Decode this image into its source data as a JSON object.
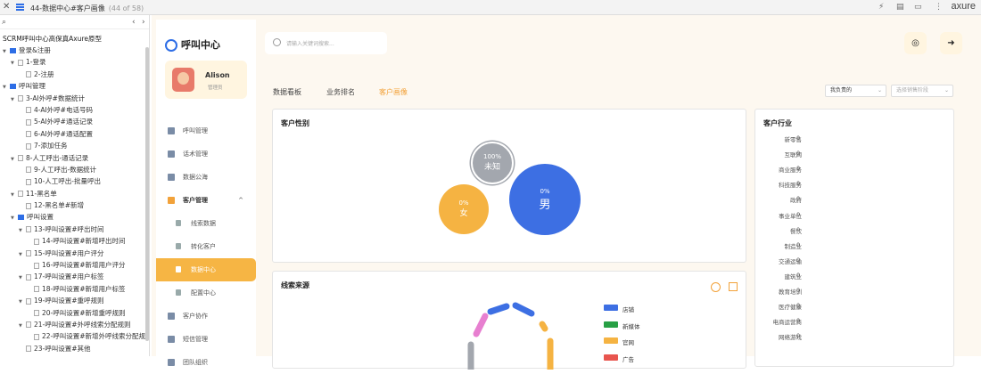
{
  "topbar": {
    "title": "44-数据中心#客户画像",
    "count": "(44 of 58)",
    "logo": "axure"
  },
  "tree": {
    "project": "SCRM呼叫中心高保真Axure原型",
    "items": [
      {
        "label": "登录&注册",
        "lvl": 0,
        "folder": true
      },
      {
        "label": "1-登录",
        "lvl": 1,
        "folder": false,
        "exp": true
      },
      {
        "label": "2-注册",
        "lvl": 2,
        "folder": false
      },
      {
        "label": "呼叫管理",
        "lvl": 0,
        "folder": true
      },
      {
        "label": "3-AI外呼#数据统计",
        "lvl": 1,
        "folder": false,
        "exp": true
      },
      {
        "label": "4-AI外呼#电话号码",
        "lvl": 2,
        "folder": false
      },
      {
        "label": "5-AI外呼#通话记录",
        "lvl": 2,
        "folder": false
      },
      {
        "label": "6-AI外呼#通话配置",
        "lvl": 2,
        "folder": false
      },
      {
        "label": "7-添加任务",
        "lvl": 2,
        "folder": false
      },
      {
        "label": "8-人工呼出-通话记录",
        "lvl": 1,
        "folder": false,
        "exp": true
      },
      {
        "label": "9-人工呼出-数据统计",
        "lvl": 2,
        "folder": false
      },
      {
        "label": "10-人工呼出-批量呼出",
        "lvl": 2,
        "folder": false
      },
      {
        "label": "11-黑名单",
        "lvl": 1,
        "folder": false,
        "exp": true
      },
      {
        "label": "12-黑名单#新增",
        "lvl": 2,
        "folder": false
      },
      {
        "label": "呼叫设置",
        "lvl": 1,
        "folder": true
      },
      {
        "label": "13-呼叫设置#呼出时间",
        "lvl": 2,
        "folder": false,
        "exp": true
      },
      {
        "label": "14-呼叫设置#新增呼出时间",
        "lvl": 3,
        "folder": false
      },
      {
        "label": "15-呼叫设置#用户评分",
        "lvl": 2,
        "folder": false,
        "exp": true
      },
      {
        "label": "16-呼叫设置#新增用户评分",
        "lvl": 3,
        "folder": false
      },
      {
        "label": "17-呼叫设置#用户标签",
        "lvl": 2,
        "folder": false,
        "exp": true
      },
      {
        "label": "18-呼叫设置#新增用户标签",
        "lvl": 3,
        "folder": false
      },
      {
        "label": "19-呼叫设置#重呼规则",
        "lvl": 2,
        "folder": false,
        "exp": true
      },
      {
        "label": "20-呼叫设置#新增重呼规则",
        "lvl": 3,
        "folder": false
      },
      {
        "label": "21-呼叫设置#外呼线索分配规则",
        "lvl": 2,
        "folder": false,
        "exp": true
      },
      {
        "label": "22-呼叫设置#新增外呼线索分配规则",
        "lvl": 3,
        "folder": false
      },
      {
        "label": "23-呼叫设置#其他",
        "lvl": 2,
        "folder": false
      }
    ]
  },
  "nav": {
    "brand": "呼叫中心",
    "user": {
      "name": "Alison",
      "role": "管理员"
    },
    "items": [
      {
        "label": "呼叫管理",
        "kind": "top"
      },
      {
        "label": "话术管理",
        "kind": "top"
      },
      {
        "label": "数据公海",
        "kind": "top"
      },
      {
        "label": "客户管理",
        "kind": "head",
        "chevron": "^"
      },
      {
        "label": "线索数据",
        "kind": "sub"
      },
      {
        "label": "转化客户",
        "kind": "sub"
      },
      {
        "label": "数据中心",
        "kind": "active"
      },
      {
        "label": "配置中心",
        "kind": "sub"
      },
      {
        "label": "客户协作",
        "kind": "top"
      },
      {
        "label": "短信管理",
        "kind": "top"
      },
      {
        "label": "团队组织",
        "kind": "top"
      }
    ]
  },
  "search": {
    "placeholder": "请输入关键词搜索..."
  },
  "tabs": [
    "数据看板",
    "业务排名",
    "客户画像"
  ],
  "active_tab": "客户画像",
  "filters": {
    "owner": "我负责的",
    "stage_placeholder": "选择销售阶段"
  },
  "gender": {
    "title": "客户性别",
    "items": [
      {
        "label": "未知",
        "pct": "100%",
        "color": "#a3a7ae"
      },
      {
        "label": "女",
        "pct": "0%",
        "color": "#f5b342"
      },
      {
        "label": "男",
        "pct": "0%",
        "color": "#3d6fe3"
      }
    ]
  },
  "industry": {
    "title": "客户行业",
    "items": [
      {
        "name": "新零售",
        "value": "0"
      },
      {
        "name": "互联网",
        "value": "0"
      },
      {
        "name": "商业服务",
        "value": "0"
      },
      {
        "name": "科技服务",
        "value": "0"
      },
      {
        "name": "政府",
        "value": "0"
      },
      {
        "name": "事业单位",
        "value": "0"
      },
      {
        "name": "餐饮",
        "value": "0"
      },
      {
        "name": "制造业",
        "value": "0"
      },
      {
        "name": "交通运输",
        "value": "0"
      },
      {
        "name": "建筑业",
        "value": "0"
      },
      {
        "name": "教育培训",
        "value": "0"
      },
      {
        "name": "医疗健康",
        "value": "0"
      },
      {
        "name": "电商运营商",
        "value": "0"
      },
      {
        "name": "网络游戏",
        "value": "0"
      }
    ]
  },
  "source": {
    "title": "线索来源",
    "legend": [
      {
        "name": "店铺",
        "color": "#3d6fe3"
      },
      {
        "name": "新媒体",
        "color": "#27a045"
      },
      {
        "name": "官网",
        "color": "#f5b342"
      },
      {
        "name": "广告",
        "color": "#e8554e"
      }
    ]
  }
}
